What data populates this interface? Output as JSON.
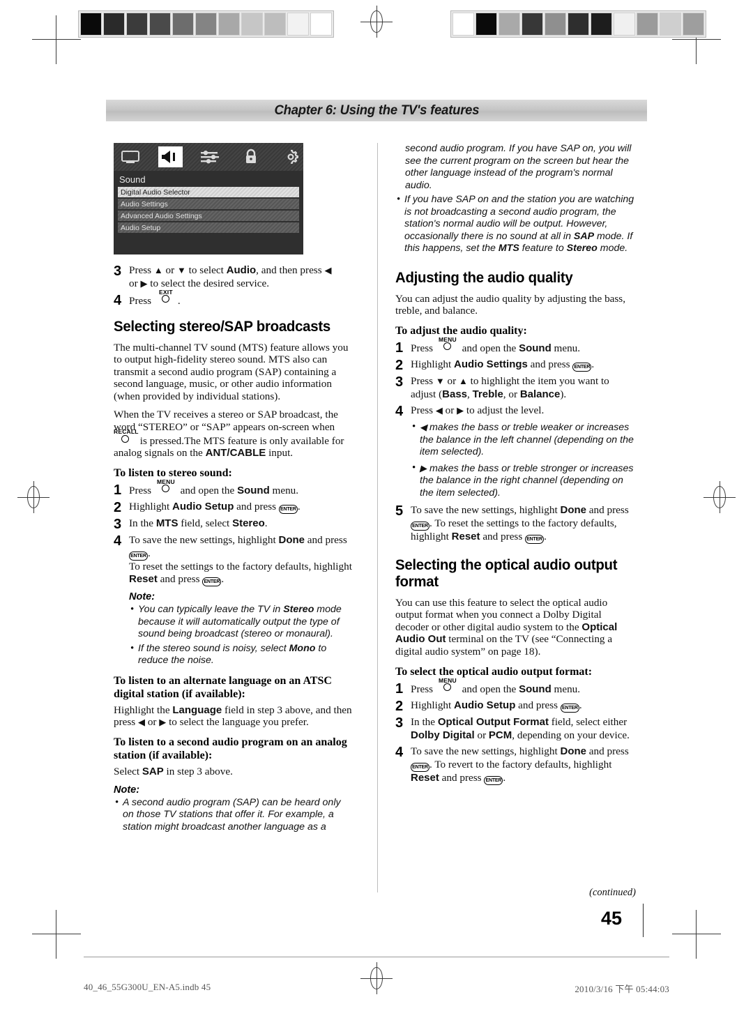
{
  "page": {
    "chapter_banner": "Chapter 6: Using the TV's features",
    "page_number": "45",
    "continued_label": "(continued)",
    "file_id": "40_46_55G300U_EN-A5.indb   45",
    "timestamp": "2010/3/16   下午 05:44:03"
  },
  "osd": {
    "icons": [
      "picture-icon",
      "sound-icon",
      "settings-sliders-icon",
      "lock-icon",
      "gear-icon"
    ],
    "selected_icon_index": 1,
    "title": "Sound",
    "items": [
      {
        "label": "Digital Audio Selector",
        "highlighted": true
      },
      {
        "label": "Audio Settings",
        "highlighted": false
      },
      {
        "label": "Advanced Audio Settings",
        "highlighted": false
      },
      {
        "label": "Audio Setup",
        "highlighted": false
      }
    ]
  },
  "left_column": {
    "step3_pre": "Press ",
    "step3_mid": " or ",
    "step3_mid2": " to select ",
    "step3_audio": "Audio",
    "step3_post": ", and then press ",
    "step3_line2": " or ",
    "step3_line2b": " to select the desired service.",
    "step4_pre": "Press ",
    "step4_button": "EXIT",
    "step4_post": ".",
    "heading_stereo_sap": "Selecting stereo/SAP broadcasts",
    "para1": "The multi-channel TV sound (MTS) feature allows you to output high-fidelity stereo sound. MTS also can transmit a second audio program (SAP) containing a second language, music, or other audio information (when provided by individual stations).",
    "para2_a": "When the TV receives a stereo or SAP broadcast, the word “STEREO” or “SAP” appears on-screen when ",
    "para2_button": "RECALL",
    "para2_b": " is pressed.The MTS feature is only available for analog signals on the ",
    "para2_antcable": "ANT/CABLE",
    "para2_c": " input.",
    "h3_stereo": "To listen to stereo sound:",
    "s1_pre": "Press ",
    "s1_button": "MENU",
    "s1_mid": " and open the ",
    "s1_bold": "Sound",
    "s1_post": " menu.",
    "s2_pre": "Highlight ",
    "s2_bold": "Audio Setup",
    "s2_mid": " and press ",
    "s2_enter": "ENTER",
    "s2_post": ".",
    "s3_pre": "In the ",
    "s3_b1": "MTS",
    "s3_mid": " field, select ",
    "s3_b2": "Stereo",
    "s3_post": ".",
    "s4_pre": "To save the new settings, highlight ",
    "s4_b1": "Done",
    "s4_mid": " and press ",
    "s4_enter": "ENTER",
    "s4_dot": ".",
    "s4_line2": "To reset the settings to the factory defaults, highlight ",
    "s4_b2": "Reset",
    "s4_line2b": " and press ",
    "s4_enter2": "ENTER",
    "s4_end": ".",
    "note_label": "Note:",
    "note1_a": "You can typically leave the TV in ",
    "note1_b": "Stereo",
    "note1_c": " mode because it will automatically output the type of sound being broadcast (stereo or monaural).",
    "note2_a": "If the stereo sound is noisy, select ",
    "note2_b": "Mono",
    "note2_c": " to reduce the noise.",
    "h3_alt_lang": "To listen to an alternate language on an ATSC digital station (if available):",
    "alt_a": "Highlight the ",
    "alt_b": "Language",
    "alt_c": " field in step 3 above, and then press ",
    "alt_d": " or ",
    "alt_e": " to select the language you prefer.",
    "h3_second_audio": "To listen to a second audio program on an analog station (if available):",
    "sap_a": "Select ",
    "sap_b": "SAP",
    "sap_c": " in step 3 above.",
    "note2_label": "Note:",
    "note3_text": "A second audio program (SAP) can be heard only on those TV stations that offer it. For example, a station might broadcast another language as a"
  },
  "right_column": {
    "cont_note_a": "second audio program. If you have SAP on, you will see the current program on the screen but hear the other language instead of the program's normal audio.",
    "note_b_1": "If you have SAP on and the station you are watching is not broadcasting a second audio program, the station's normal audio will be output. However, occasionally there is no sound at all in ",
    "note_b_sap": "SAP",
    "note_b_2": " mode. If this happens, set the ",
    "note_b_mts": "MTS",
    "note_b_3": " feature to ",
    "note_b_stereo": "Stereo",
    "note_b_4": " mode.",
    "heading_audio_quality": "Adjusting the audio quality",
    "aq_para": "You can adjust the audio quality by adjusting the bass, treble, and balance.",
    "h3_adjust": "To adjust the audio quality:",
    "aq1_pre": "Press ",
    "aq1_button": "MENU",
    "aq1_mid": " and open the ",
    "aq1_bold": "Sound",
    "aq1_post": " menu.",
    "aq2_pre": "Highlight ",
    "aq2_bold": "Audio Settings",
    "aq2_mid": " and press ",
    "aq2_enter": "ENTER",
    "aq2_post": ".",
    "aq3_pre": "Press ",
    "aq3_mid": " or ",
    "aq3_post": " to highlight the item you want to adjust (",
    "aq3_b1": "Bass",
    "aq3_sep1": ", ",
    "aq3_b2": "Treble",
    "aq3_sep2": ", or ",
    "aq3_b3": "Balance",
    "aq3_end": ").",
    "aq4_pre": "Press ",
    "aq4_mid": " or ",
    "aq4_post": " to adjust the level.",
    "aq_bul1": " makes the bass or treble weaker or increases the balance in the left channel (depending on the item selected).",
    "aq_bul2": " makes the bass or treble stronger or increases the balance in the right channel (depending on the item selected).",
    "aq5_pre": "To save the new settings, highlight ",
    "aq5_b1": "Done",
    "aq5_mid": " and press ",
    "aq5_enter": "ENTER",
    "aq5_mid2": ". To reset the settings to the factory defaults, highlight ",
    "aq5_b2": "Reset",
    "aq5_mid3": " and press ",
    "aq5_enter2": "ENTER",
    "aq5_end": ".",
    "heading_optical": "Selecting the optical audio output format",
    "opt_para_a": "You can use this feature to select the optical audio output format when you connect a Dolby Digital decoder or other digital audio system to the ",
    "opt_para_b": "Optical Audio Out",
    "opt_para_c": " terminal on the TV (see “Connecting a digital audio system” on page 18).",
    "h3_optical": "To select the optical audio output format:",
    "op1_pre": "Press ",
    "op1_button": "MENU",
    "op1_mid": " and open the ",
    "op1_bold": "Sound",
    "op1_post": " menu.",
    "op2_pre": "Highlight ",
    "op2_bold": "Audio Setup",
    "op2_mid": " and press ",
    "op2_enter": "ENTER",
    "op2_post": ".",
    "op3_pre": "In the ",
    "op3_b1": "Optical Output Format",
    "op3_mid": " field, select either ",
    "op3_b2": "Dolby Digital",
    "op3_mid2": " or ",
    "op3_b3": "PCM",
    "op3_end": ", depending on your device.",
    "op4_pre": "To save the new settings, highlight ",
    "op4_b1": "Done",
    "op4_mid": " and press ",
    "op4_enter": "ENTER",
    "op4_mid2": ". To revert to the factory defaults, highlight ",
    "op4_b2": "Reset",
    "op4_mid3": " and press ",
    "op4_enter2": "ENTER",
    "op4_end": "."
  },
  "calibration": {
    "left_swatches": [
      "#0a0a0a",
      "#2a2a2a",
      "#3b3b3b",
      "#4a4a4a",
      "#6d6d6d",
      "#848484",
      "#a8a8a8",
      "#c6c6c6",
      "#bdbdbd",
      "#f2f2f2",
      "#ffffff"
    ],
    "right_swatches": [
      "#ffffff",
      "#0a0a0a",
      "#a9a9a9",
      "#373737",
      "#8f8f8f",
      "#2e2e2e",
      "#1d1d1d",
      "#f0f0f0",
      "#9b9b9b",
      "#cfcfcf",
      "#9e9e9e"
    ]
  }
}
